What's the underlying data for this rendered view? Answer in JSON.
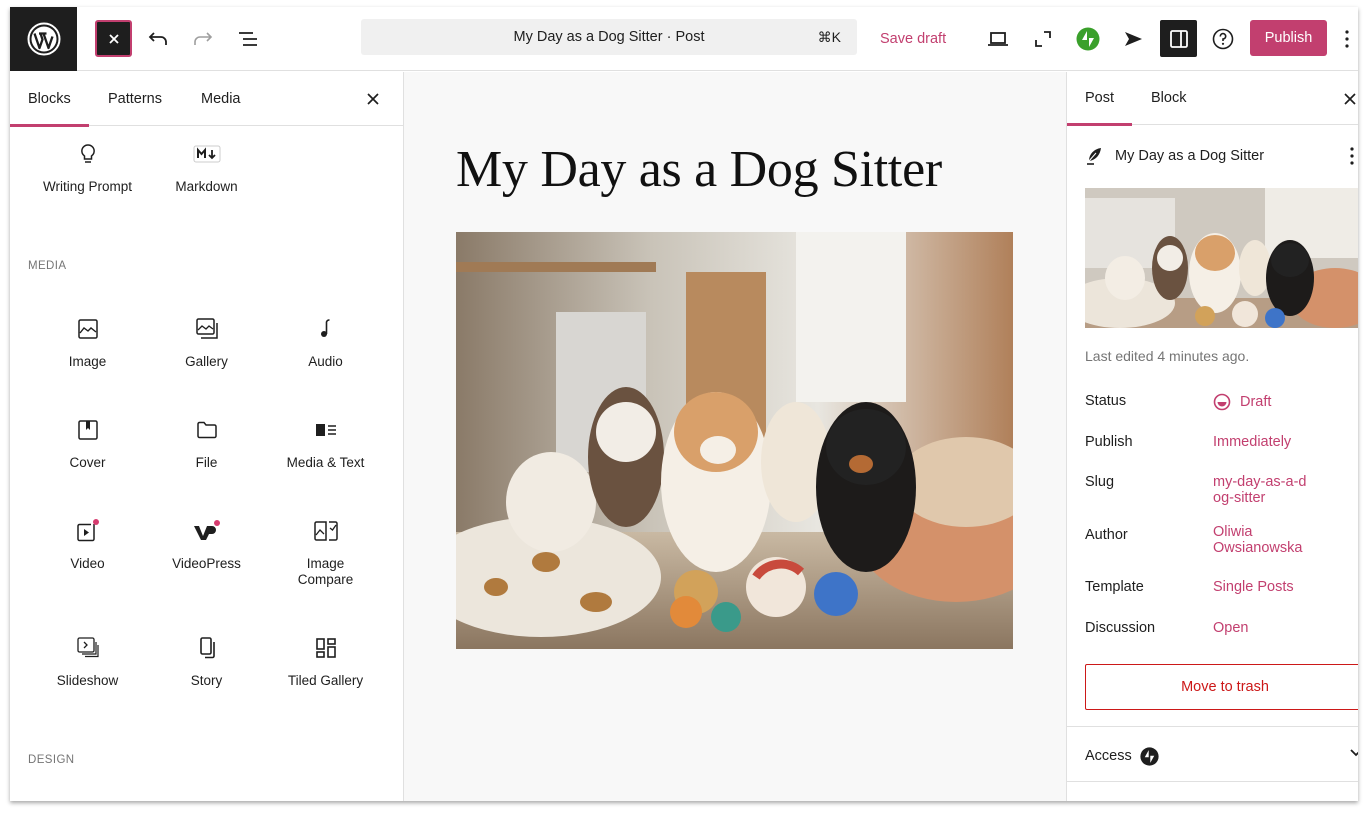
{
  "toolbar": {
    "command_bar_text": "My Day as a Dog Sitter · Post",
    "command_shortcut": "⌘K",
    "save_draft_label": "Save draft",
    "publish_label": "Publish",
    "accent_color": "#c23f6f"
  },
  "inserter": {
    "tabs": [
      {
        "label": "Blocks",
        "active": true
      },
      {
        "label": "Patterns",
        "active": false
      },
      {
        "label": "Media",
        "active": false
      }
    ],
    "top_blocks": [
      {
        "label": "Writing Prompt",
        "icon": "lightbulb-icon"
      },
      {
        "label": "Markdown",
        "icon": "markdown-icon"
      }
    ],
    "sections": [
      {
        "title": "MEDIA",
        "blocks": [
          {
            "label": "Image",
            "icon": "image-icon"
          },
          {
            "label": "Gallery",
            "icon": "gallery-icon"
          },
          {
            "label": "Audio",
            "icon": "audio-icon"
          },
          {
            "label": "Cover",
            "icon": "cover-icon"
          },
          {
            "label": "File",
            "icon": "file-icon"
          },
          {
            "label": "Media & Text",
            "icon": "media-text-icon"
          },
          {
            "label": "Video",
            "icon": "video-icon"
          },
          {
            "label": "VideoPress",
            "icon": "videopress-icon"
          },
          {
            "label": "Image\nCompare",
            "icon": "image-compare-icon"
          },
          {
            "label": "Slideshow",
            "icon": "slideshow-icon"
          },
          {
            "label": "Story",
            "icon": "story-icon"
          },
          {
            "label": "Tiled Gallery",
            "icon": "tiled-gallery-icon"
          }
        ]
      },
      {
        "title": "DESIGN",
        "blocks": []
      }
    ]
  },
  "canvas": {
    "post_title": "My Day as a Dog Sitter",
    "featured_image_alt": "Puppies playing with balls on pillows in a living room"
  },
  "sidebar": {
    "tabs": [
      {
        "label": "Post",
        "active": true
      },
      {
        "label": "Block",
        "active": false
      }
    ],
    "post_name": "My Day as a Dog Sitter",
    "last_edited": "Last edited 4 minutes ago.",
    "meta": [
      {
        "key": "Status",
        "value": "Draft"
      },
      {
        "key": "Publish",
        "value": "Immediately"
      },
      {
        "key": "Slug",
        "value": "my-day-as-a-dog-sitter"
      },
      {
        "key": "Author",
        "value": "Oliwia Owsianowska"
      },
      {
        "key": "Template",
        "value": "Single Posts"
      },
      {
        "key": "Discussion",
        "value": "Open"
      }
    ],
    "trash_label": "Move to trash",
    "access_label": "Access"
  }
}
